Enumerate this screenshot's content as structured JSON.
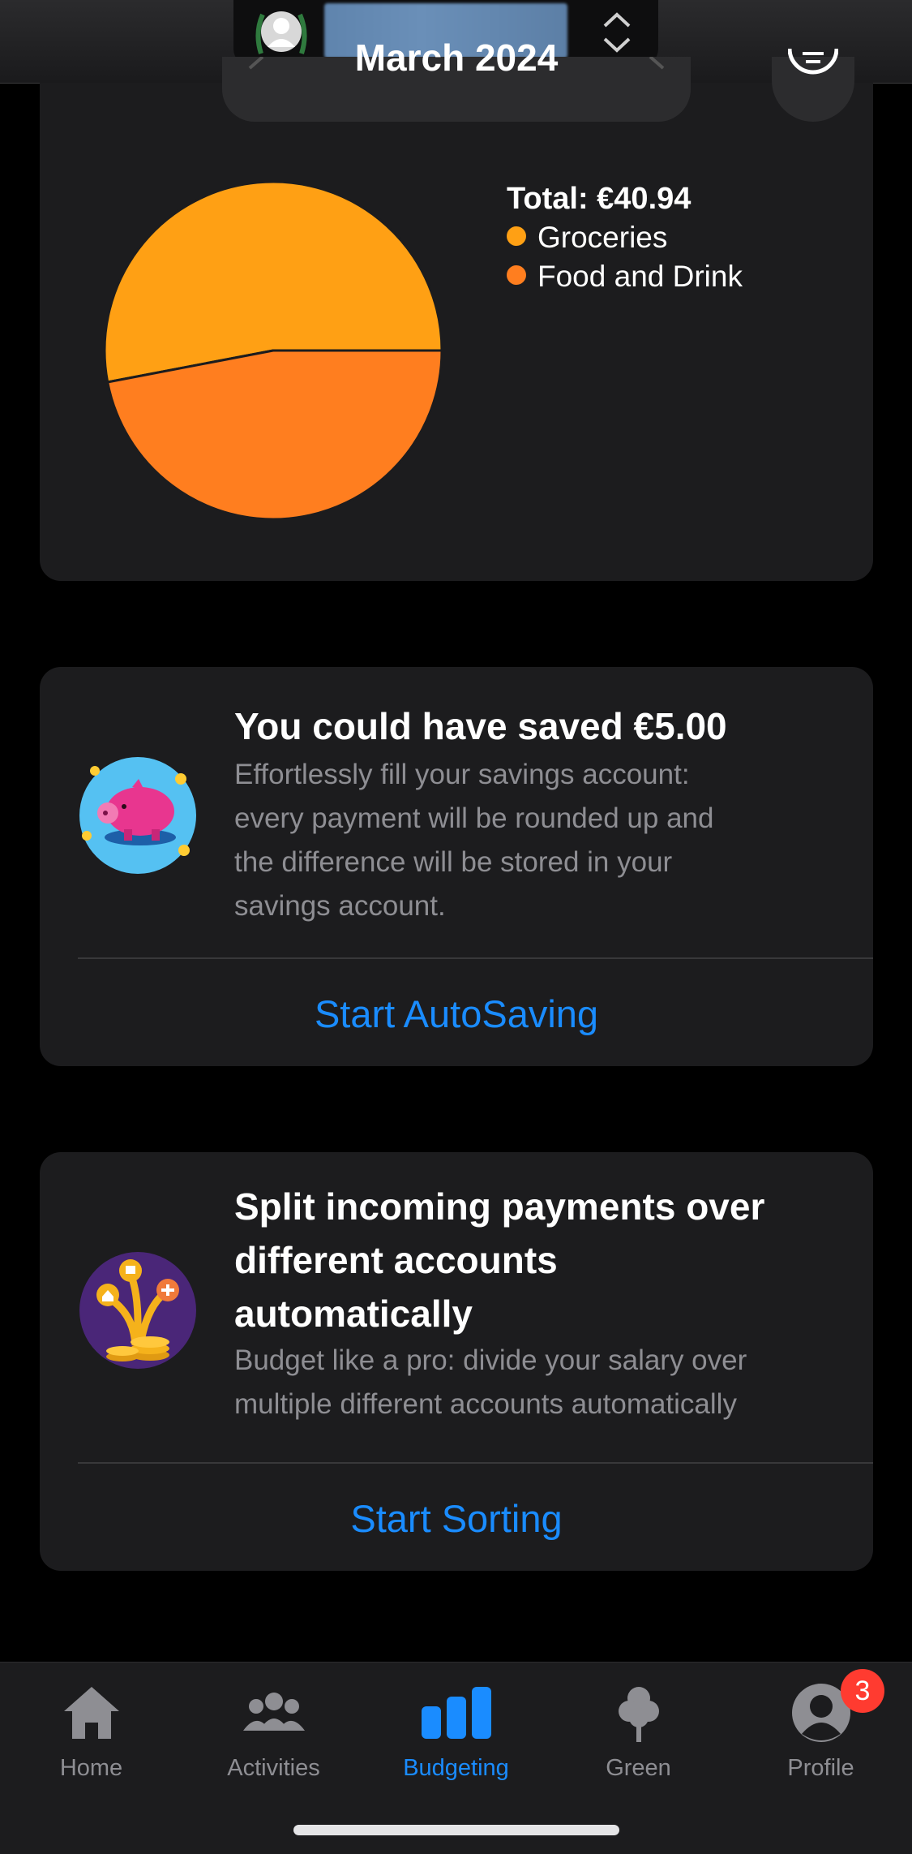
{
  "header": {
    "month": "March 2024",
    "account_switch_icon": "chevron-up-down-icon",
    "menu_icon": "filter-lines-icon"
  },
  "chart_data": {
    "type": "pie",
    "total_label": "Total: €40.94",
    "categories": [
      "Groceries",
      "Food and Drink"
    ],
    "values": [
      53,
      47
    ],
    "colors": [
      "#ffa014",
      "#ff7e1f"
    ]
  },
  "autosave": {
    "title": "You could have saved €5.00",
    "description_lines": [
      "Effortlessly fill your savings account:",
      "every payment will be rounded up and",
      "the difference will be stored in your",
      "savings account."
    ],
    "action": "Start AutoSaving",
    "icon": "piggy-bank-icon"
  },
  "split": {
    "title_lines": [
      "Split incoming payments over",
      "different accounts",
      "automatically"
    ],
    "description_lines": [
      "Budget like a pro: divide your salary over",
      "multiple different accounts automatically"
    ],
    "action": "Start Sorting",
    "icon": "money-tree-icon"
  },
  "tabs": [
    {
      "label": "Home",
      "icon": "house-icon",
      "active": false
    },
    {
      "label": "Activities",
      "icon": "people-icon",
      "active": false
    },
    {
      "label": "Budgeting",
      "icon": "bar-chart-icon",
      "active": true
    },
    {
      "label": "Green",
      "icon": "tree-icon",
      "active": false
    },
    {
      "label": "Profile",
      "icon": "person-icon",
      "active": false
    }
  ],
  "profile_badge": "3",
  "colors": {
    "accent": "#1a8cff",
    "card": "#1c1c1e",
    "badge": "#ff3b30"
  }
}
